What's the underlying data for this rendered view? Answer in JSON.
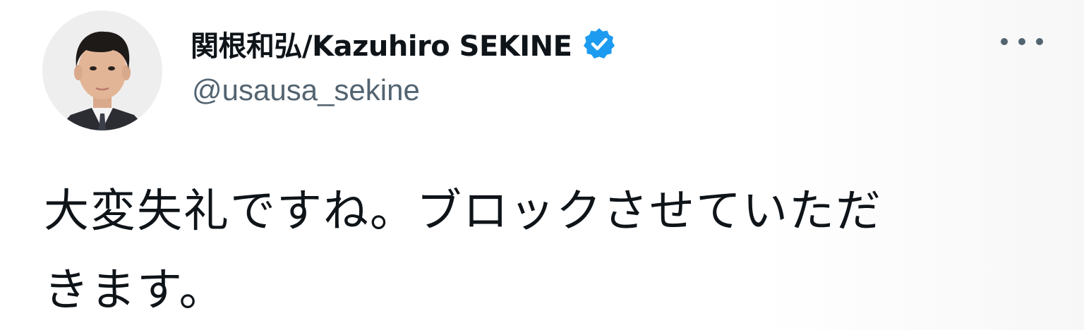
{
  "author": {
    "display_name": "関根和弘/Kazuhiro SEKINE",
    "handle": "@usausa_sekine",
    "verified": true,
    "verified_icon": "verified-badge-icon",
    "avatar": "profile-photo"
  },
  "menu": {
    "icon": "more-options-icon"
  },
  "tweet": {
    "lines": [
      "大変失礼ですね。ブロックさせていただ",
      "きます。"
    ]
  },
  "colors": {
    "text": "#0f1419",
    "secondary_text": "#536471",
    "verified_blue": "#1d9bf0",
    "background": "#ffffff"
  }
}
